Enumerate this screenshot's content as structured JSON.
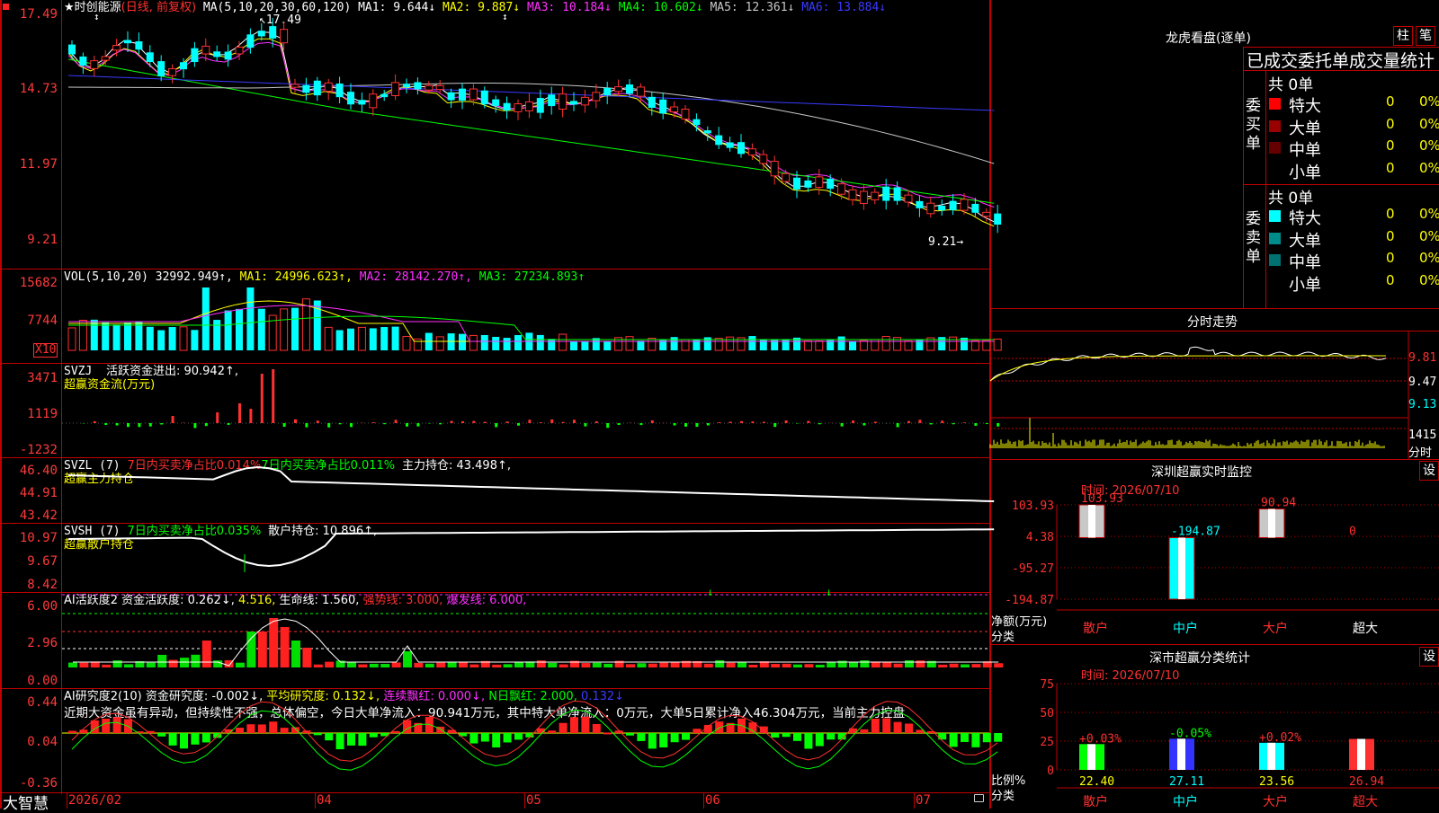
{
  "status": {
    "brand": "大智慧",
    "axis_dates": [
      "2026/02",
      "04",
      "05",
      "06",
      "07"
    ]
  },
  "main_chart": {
    "title": "★时创能源",
    "mode": "(日线, 前复权)",
    "ma_header": "MA(5,10,20,30,60,120)",
    "ma_values": [
      {
        "label": "MA1: 9.644↓",
        "color": "#ffffff"
      },
      {
        "label": "MA2: 9.887↓",
        "color": "#ffff00"
      },
      {
        "label": "MA3: 10.184↓",
        "color": "#ff30ff"
      },
      {
        "label": "MA4: 10.602↓",
        "color": "#00ff00"
      },
      {
        "label": "MA5: 12.361↓",
        "color": "#c8c8c8"
      },
      {
        "label": "MA6: 13.884↓",
        "color": "#3a3aff"
      }
    ],
    "y_ticks": [
      "17.49",
      "14.73",
      "11.97",
      "9.21"
    ],
    "high_label": "17.49",
    "low_label": "9.21"
  },
  "vol_panel": {
    "header": "VOL(5,10,20)",
    "value": "32992.949↑,",
    "ma1": "MA1: 24996.623↑,",
    "ma2": "MA2: 28142.270↑,",
    "ma3": "MA3: 27234.893↑",
    "y_ticks": [
      "15682",
      "7744"
    ],
    "unit": "X10"
  },
  "svzj_panel": {
    "header": "SVZJ",
    "label": "活跃资金进出: 90.942↑,",
    "sub": "超赢资金流(万元)",
    "y_ticks": [
      "3471",
      "1119",
      "-1232"
    ]
  },
  "svzl_panel": {
    "header": "SVZL (7)",
    "a": "7日内买卖净占比0.014%",
    "b": "7日内买卖净占比0.011%",
    "c": "主力持仓: 43.498↑,",
    "sub": "超赢主力持仓",
    "y_ticks": [
      "46.40",
      "44.91",
      "43.42"
    ]
  },
  "svsh_panel": {
    "header": "SVSH (7)",
    "a": "7日内买卖净占比0.035%",
    "b": "散户持仓: 10.896↑,",
    "sub": "超赢散户持仓",
    "y_ticks": [
      "10.97",
      "9.67",
      "8.42"
    ]
  },
  "ai_active_panel": {
    "header": "AI活跃度2",
    "a": "资金活跃度: 0.262↓,",
    "b": "4.516,",
    "c": "生命线: 1.560,",
    "d": "强势线: 3.000,",
    "e": "爆发线: 6.000,",
    "y_ticks": [
      "6.00",
      "2.96",
      "0.00"
    ]
  },
  "ai_research_panel": {
    "header": "AI研究度2(10)",
    "a": "资金研究度: -0.002↓,",
    "b": "平均研究度: 0.132↓,",
    "c": "连续飘红: 0.000↓,",
    "d": "N日飘红: 2.000,",
    "e": "0.132↓",
    "comment": "近期大资金虽有异动，但持续性不强，总体偏空，今日大单净流入：90.941万元，其中特大单净流入：0万元，大单5日累计净入46.304万元，当前主力控盘",
    "y_ticks": [
      "0.44",
      "0.04",
      "-0.36"
    ]
  },
  "right": {
    "dragon_title": "龙虎看盘(逐单)",
    "btn_zhu": "柱",
    "btn_bi": "笔",
    "orders_header": "已成交委托单成交量统计",
    "buy_side": "委买单",
    "sell_side": "委卖单",
    "buy_total": "共 0单",
    "sell_total": "共 0单",
    "buy_rows": [
      {
        "name": "特大",
        "count": "0",
        "pct": "0%",
        "color": "#ff0000"
      },
      {
        "name": "大单",
        "count": "0",
        "pct": "0%",
        "color": "#990000"
      },
      {
        "name": "中单",
        "count": "0",
        "pct": "0%",
        "color": "#660000"
      },
      {
        "name": "小单",
        "count": "0",
        "pct": "0%",
        "color": "#000000"
      }
    ],
    "sell_rows": [
      {
        "name": "特大",
        "count": "0",
        "pct": "0%",
        "color": "#00ffff"
      },
      {
        "name": "大单",
        "count": "0",
        "pct": "0%",
        "color": "#008b8b"
      },
      {
        "name": "中单",
        "count": "0",
        "pct": "0%",
        "color": "#007070"
      },
      {
        "name": "小单",
        "count": "0",
        "pct": "0%",
        "color": "#000000"
      }
    ],
    "intraday_title": "分时走势",
    "intraday_ticks": [
      "9.81",
      "9.47",
      "9.13"
    ],
    "intraday_vol": "1415",
    "intraday_label": "分时",
    "monitor_title": "深圳超赢实时监控",
    "monitor_btn": "设",
    "monitor_time": "时间: 2026/07/10",
    "monitor_ticks": [
      "103.93",
      "4.38",
      "-95.27",
      "-194.87"
    ],
    "monitor_ylabel": "净额(万元)",
    "monitor_xlabel": "分类",
    "monitor_values": [
      "103.93",
      "-194.87",
      "90.94",
      "0"
    ],
    "monitor_categories": [
      "散户",
      "中户",
      "大户",
      "超大"
    ],
    "class_title": "深市超赢分类统计",
    "class_btn": "设",
    "class_time": "时间: 2026/07/10",
    "class_ticks": [
      "75",
      "50",
      "25",
      "0"
    ],
    "class_ylabel": "比例%",
    "class_xlabel": "分类",
    "class_changes": [
      "+0.03%",
      "-0.05%",
      "+0.02%",
      ""
    ],
    "class_values": [
      "22.40",
      "27.11",
      "23.56",
      "26.94"
    ],
    "class_categories": [
      "散户",
      "中户",
      "大户",
      "超大"
    ]
  },
  "chart_data": [
    {
      "type": "bar",
      "title": "深圳超赢实时监控",
      "ylabel": "净额(万元)",
      "xlabel": "分类",
      "categories": [
        "散户",
        "中户",
        "大户",
        "超大"
      ],
      "values": [
        103.93,
        -194.87,
        90.94,
        0
      ],
      "ylim": [
        -194.87,
        103.93
      ]
    },
    {
      "type": "bar",
      "title": "深市超赢分类统计",
      "ylabel": "比例%",
      "xlabel": "分类",
      "categories": [
        "散户",
        "中户",
        "大户",
        "超大"
      ],
      "values": [
        22.4,
        27.11,
        23.56,
        26.94
      ],
      "ylim": [
        0,
        75
      ]
    }
  ]
}
